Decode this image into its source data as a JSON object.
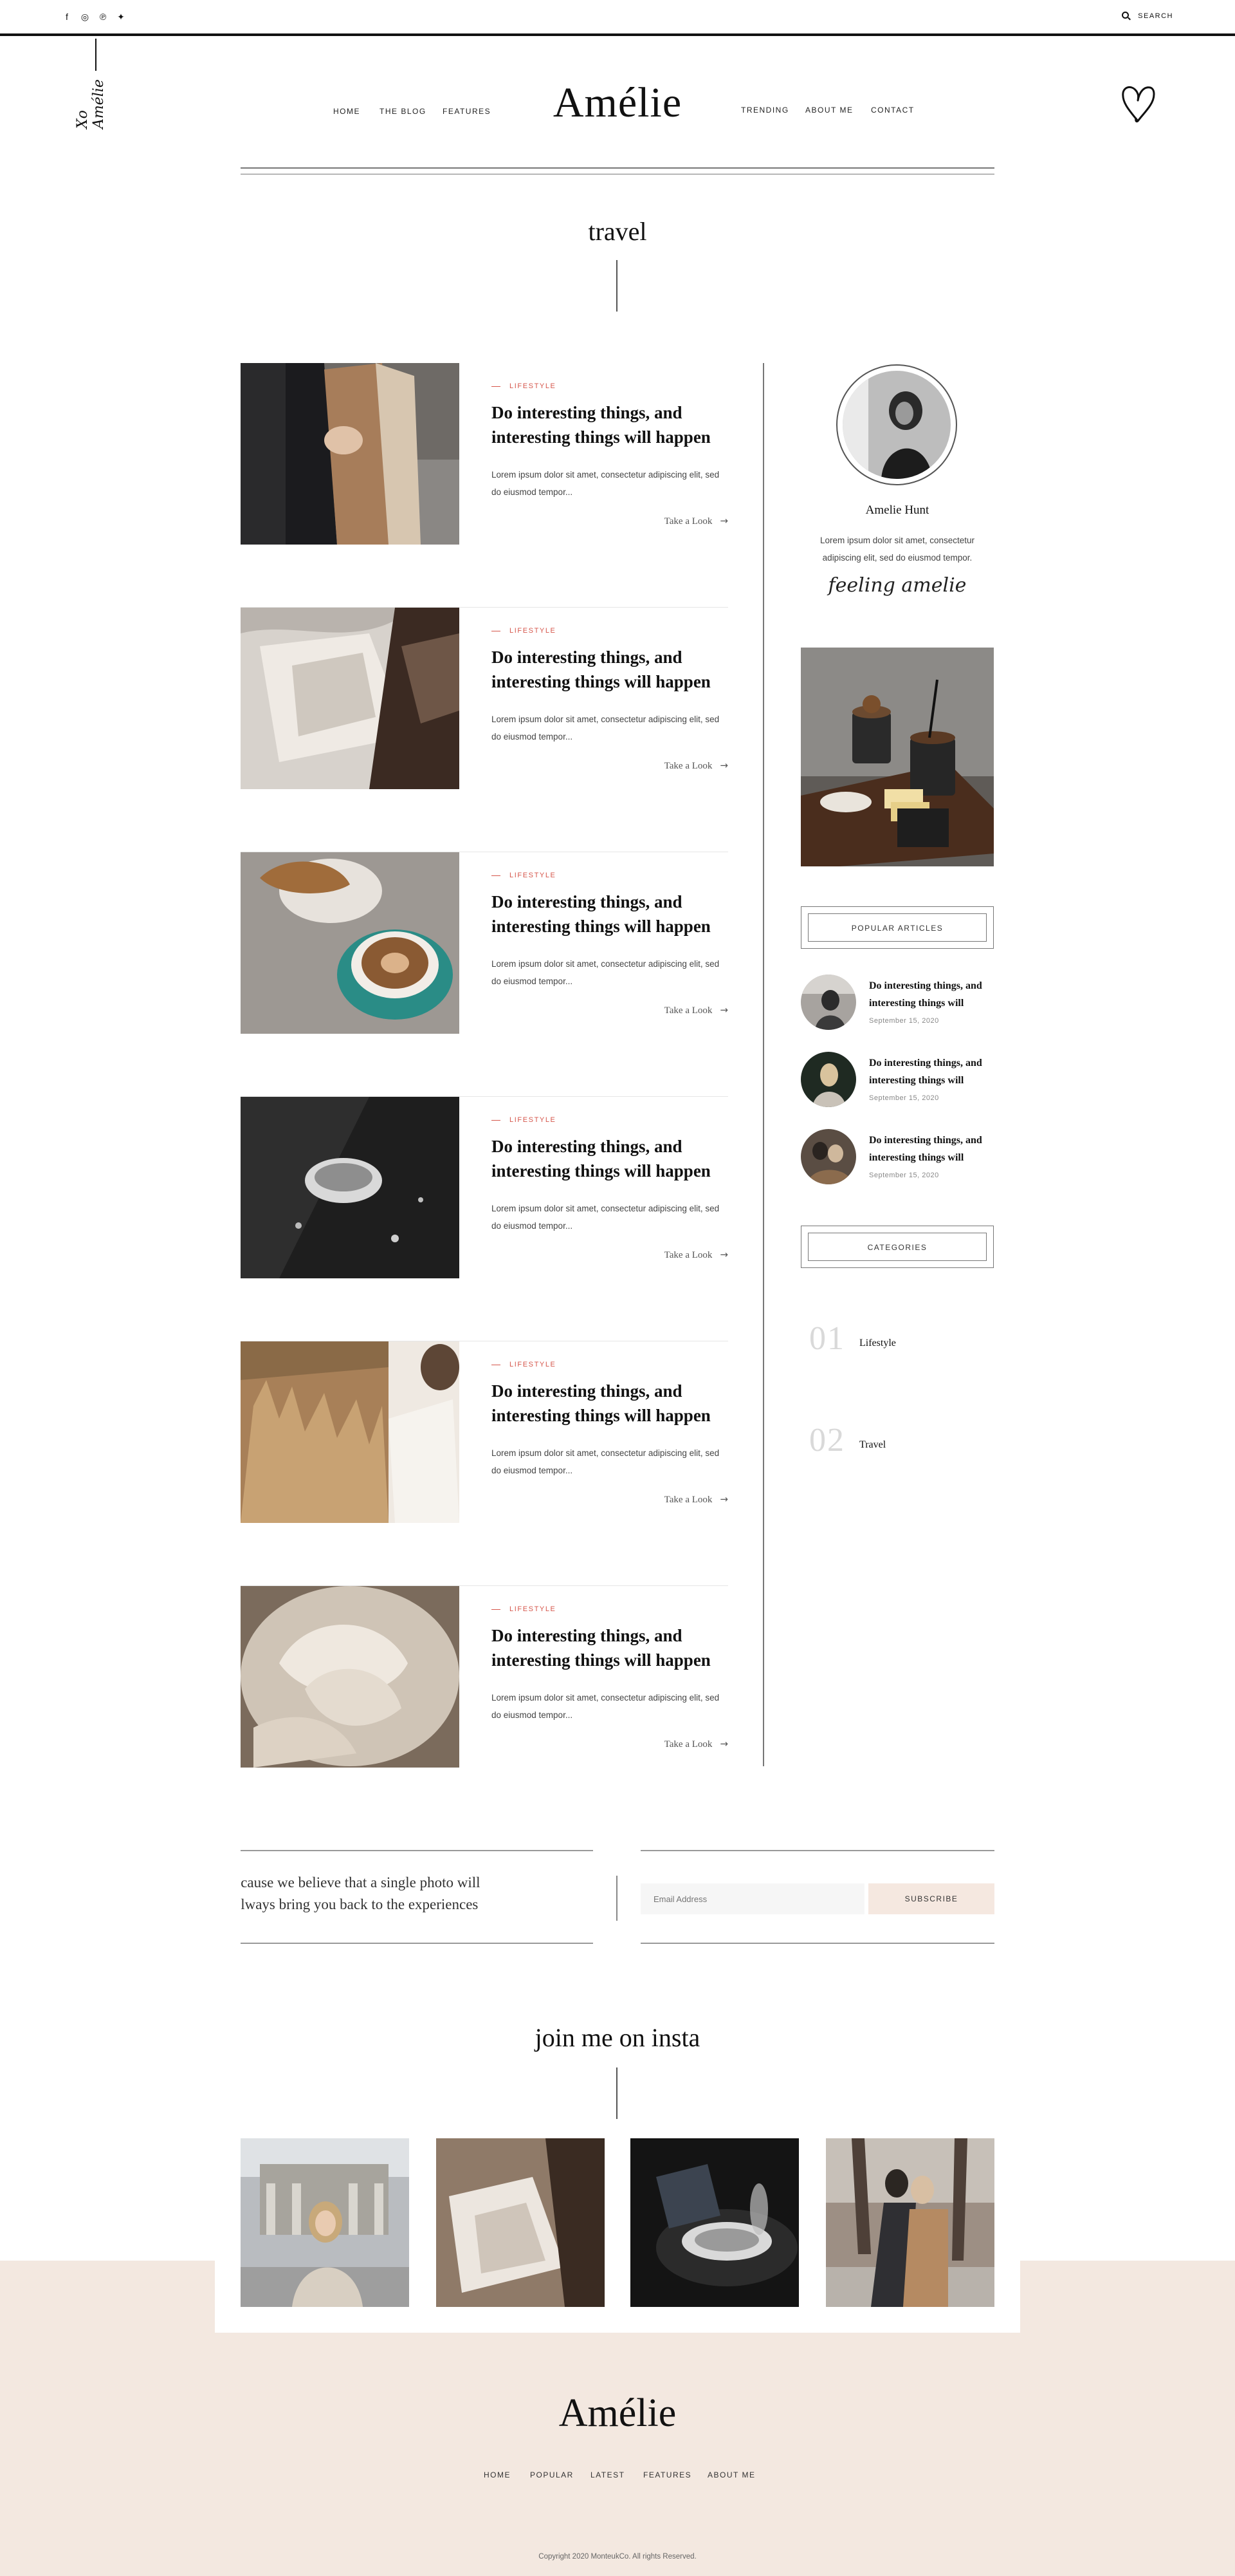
{
  "topbar": {
    "social": [
      {
        "name": "facebook-icon",
        "glyph": "f"
      },
      {
        "name": "instagram-icon",
        "glyph": "◎"
      },
      {
        "name": "pinterest-icon",
        "glyph": "℗"
      },
      {
        "name": "twitter-icon",
        "glyph": "✦"
      }
    ],
    "search_label": "SEARCH"
  },
  "header": {
    "logo": "Amélie",
    "signature": "Xo Amélie",
    "nav_left": [
      "HOME",
      "THE BLOG",
      "FEATURES"
    ],
    "nav_right": [
      "TRENDING",
      "ABOUT ME",
      "CONTACT"
    ]
  },
  "page": {
    "title": "travel"
  },
  "posts": [
    {
      "category": "LIFESTYLE",
      "title": "Do interesting things, and interesting things will happen",
      "excerpt": "Lorem ipsum dolor sit amet, consectetur adipiscing elit, sed do eiusmod tempor...",
      "more": "Take a Look"
    },
    {
      "category": "LIFESTYLE",
      "title": "Do interesting things, and interesting things will happen",
      "excerpt": "Lorem ipsum dolor sit amet, consectetur adipiscing elit, sed do eiusmod tempor...",
      "more": "Take a Look"
    },
    {
      "category": "LIFESTYLE",
      "title": "Do interesting things, and interesting things will happen",
      "excerpt": "Lorem ipsum dolor sit amet, consectetur adipiscing elit, sed do eiusmod tempor...",
      "more": "Take a Look"
    },
    {
      "category": "LIFESTYLE",
      "title": "Do interesting things, and interesting things will happen",
      "excerpt": "Lorem ipsum dolor sit amet, consectetur adipiscing elit, sed do eiusmod tempor...",
      "more": "Take a Look"
    },
    {
      "category": "LIFESTYLE",
      "title": "Do interesting things, and interesting things will happen",
      "excerpt": "Lorem ipsum dolor sit amet, consectetur adipiscing elit, sed do eiusmod tempor...",
      "more": "Take a Look"
    },
    {
      "category": "LIFESTYLE",
      "title": "Do interesting things, and interesting things will happen",
      "excerpt": "Lorem ipsum dolor sit amet, consectetur adipiscing elit, sed do eiusmod tempor...",
      "more": "Take a Look"
    }
  ],
  "sidebar": {
    "author_name": "Amelie Hunt",
    "author_bio": "Lorem ipsum dolor sit amet, consectetur adipiscing elit, sed do eiusmod tempor.",
    "author_signature": "feeling amelie",
    "popular_title": "POPULAR ARTICLES",
    "popular": [
      {
        "title": "Do interesting things, and interesting things will",
        "date": "September 15, 2020"
      },
      {
        "title": "Do interesting things, and interesting things will",
        "date": "September 15, 2020"
      },
      {
        "title": "Do interesting things, and interesting things will",
        "date": "September 15, 2020"
      }
    ],
    "categories_title": "CATEGORIES",
    "categories": [
      {
        "num": "01",
        "name": "Lifestyle"
      },
      {
        "num": "02",
        "name": "Travel"
      }
    ]
  },
  "newsletter": {
    "line1": "ecause we believe that a single photo will",
    "line2": "always bring you back to the experiences",
    "email_placeholder": "Email Address",
    "subscribe_label": "SUBSCRIBE"
  },
  "insta": {
    "title": "join me on insta"
  },
  "footer": {
    "logo": "Amélie",
    "nav": [
      "HOME",
      "POPULAR",
      "LATEST",
      "FEATURES",
      "ABOUT ME"
    ],
    "copyright": "Copyright 2020 MonteukCo. All rights Reserved."
  },
  "colors": {
    "accent": "#d6564b",
    "footer_bg": "#f3e8e0",
    "subscribe_bg": "#f5e8e0"
  }
}
